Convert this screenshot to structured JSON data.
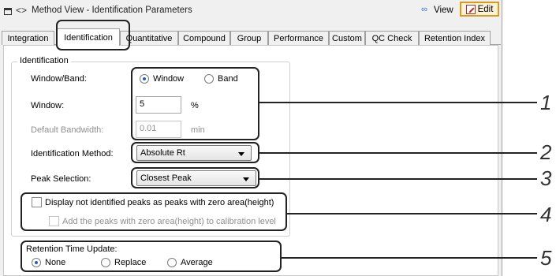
{
  "window": {
    "title": "Method View - Identification Parameters",
    "view_label": "View",
    "edit_label": "Edit"
  },
  "tabs": [
    {
      "label": "Integration"
    },
    {
      "label": "Identification"
    },
    {
      "label": "Quantitative"
    },
    {
      "label": "Compound"
    },
    {
      "label": "Group"
    },
    {
      "label": "Performance"
    },
    {
      "label": "Custom"
    },
    {
      "label": "QC Check"
    },
    {
      "label": "Retention Index"
    }
  ],
  "identification": {
    "group_title": "Identification",
    "window_band": {
      "label": "Window/Band:",
      "options": [
        "Window",
        "Band"
      ],
      "selected": "Window"
    },
    "window": {
      "label": "Window:",
      "value": "5",
      "unit": "%"
    },
    "default_bandwidth": {
      "label": "Default Bandwidth:",
      "value": "0.01",
      "unit": "min"
    },
    "method": {
      "label": "Identification Method:",
      "value": "Absolute Rt"
    },
    "peak_selection": {
      "label": "Peak Selection:",
      "value": "Closest Peak"
    },
    "display_unidentified": {
      "label": "Display not identified peaks as peaks with zero area(height)",
      "checked": false
    },
    "add_peaks": {
      "label": "Add the peaks with zero area(height) to calibration level",
      "checked": false
    }
  },
  "retention": {
    "label": "Retention Time Update:",
    "options": [
      "None",
      "Replace",
      "Average"
    ],
    "selected": "None"
  },
  "callouts": [
    "1",
    "2",
    "3",
    "4",
    "5"
  ]
}
